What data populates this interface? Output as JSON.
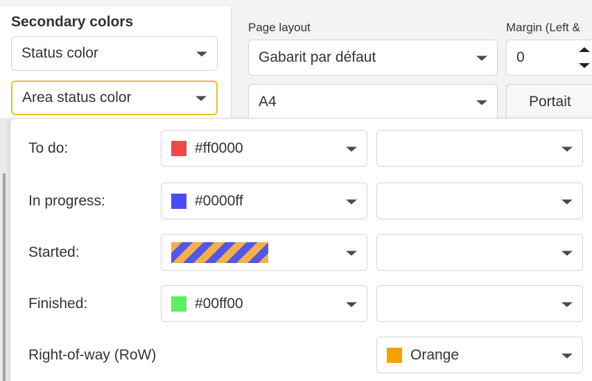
{
  "secondary_colors": {
    "title": "Secondary colors",
    "status_color": "Status color",
    "area_status_color": "Area status color"
  },
  "page_layout": {
    "label": "Page layout",
    "template_value": "Gabarit par défaut",
    "paper_value": "A4"
  },
  "margin": {
    "label": "Margin (Left &",
    "value": "0",
    "orientation_button": "Portait"
  },
  "status_rows": [
    {
      "label": "To do:",
      "color_text": "#ff0000",
      "swatch": "#f24848"
    },
    {
      "label": "In progress:",
      "color_text": "#0000ff",
      "swatch": "#4b4bf5"
    },
    {
      "label": "Started:",
      "color_text": "",
      "swatch": "striped"
    },
    {
      "label": "Finished:",
      "color_text": "#00ff00",
      "swatch": "#5cf05c"
    }
  ],
  "right_of_way": {
    "label": "Right-of-way (RoW)",
    "color_text": "Orange",
    "swatch": "#f5a200"
  },
  "colors": {
    "accent_border": "#e8c12e",
    "stripe_a": "#5555e6",
    "stripe_b": "#f3b04a"
  }
}
